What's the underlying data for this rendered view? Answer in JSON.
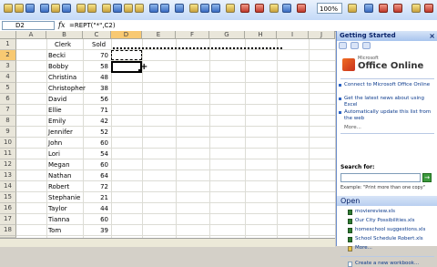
{
  "toolbar": {
    "zoom": "100%"
  },
  "formula_bar": {
    "name_box": "D2",
    "fx": "fx",
    "formula": "=REPT(\"*\",C2)"
  },
  "sheet": {
    "columns": [
      "A",
      "B",
      "C",
      "D",
      "E",
      "F",
      "G",
      "H",
      "I",
      "J"
    ],
    "selected_column": "D",
    "rows": [
      "1",
      "2",
      "3",
      "4",
      "5",
      "6",
      "7",
      "8",
      "9",
      "10",
      "11",
      "12",
      "13",
      "14",
      "15",
      "16",
      "17",
      "18",
      "19"
    ],
    "selected_row": "2",
    "headers": {
      "name": "Clerk",
      "sold": "Sold"
    },
    "data": [
      {
        "name": "Becki",
        "sold": "70"
      },
      {
        "name": "Bobby",
        "sold": "58"
      },
      {
        "name": "Christina",
        "sold": "48"
      },
      {
        "name": "Christopher",
        "sold": "38"
      },
      {
        "name": "David",
        "sold": "56"
      },
      {
        "name": "Ellie",
        "sold": "71"
      },
      {
        "name": "Emily",
        "sold": "42"
      },
      {
        "name": "Jennifer",
        "sold": "52"
      },
      {
        "name": "John",
        "sold": "60"
      },
      {
        "name": "Lori",
        "sold": "54"
      },
      {
        "name": "Megan",
        "sold": "60"
      },
      {
        "name": "Nathan",
        "sold": "64"
      },
      {
        "name": "Robert",
        "sold": "72"
      },
      {
        "name": "Stephanie",
        "sold": "21"
      },
      {
        "name": "Taylor",
        "sold": "44"
      },
      {
        "name": "Tianna",
        "sold": "60"
      },
      {
        "name": "Tom",
        "sold": "39"
      }
    ]
  },
  "pane": {
    "title": "Getting Started",
    "close": "×",
    "logo_small": "Microsoft",
    "logo_big": "Office Online",
    "links": [
      "Connect to Microsoft Office Online",
      "Get the latest news about using Excel",
      "Automatically update this list from the web"
    ],
    "more": "More...",
    "search_label": "Search for:",
    "go": "→",
    "example": "Example: \"Print more than one copy\"",
    "open_header": "Open",
    "files": [
      "moviereview.xls",
      "Our City Possibilities.xls",
      "homeschool suggestions.xls",
      "School Schedule Robert.xls",
      "More..."
    ],
    "create": "Create a new workbook..."
  },
  "colors": {
    "selected_header": "#f8c972",
    "pane_accent": "#0a246a"
  }
}
